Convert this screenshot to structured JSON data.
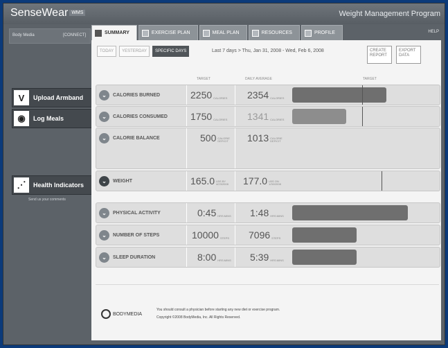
{
  "app": {
    "logo": "SenseWear",
    "logo_badge": "WMS",
    "program_title": "Weight Management Program",
    "help": "HELP"
  },
  "sidebar": {
    "media_label": "Body Media",
    "media_right": "[CONNECT]",
    "items": [
      {
        "label": "Upload Armband"
      },
      {
        "label": "Log Meals"
      },
      {
        "label": "Health Indicators"
      }
    ],
    "note": "Send us your comments"
  },
  "tabs": [
    {
      "label": "SUMMARY"
    },
    {
      "label": "EXERCISE PLAN"
    },
    {
      "label": "MEAL PLAN"
    },
    {
      "label": "RESOURCES"
    },
    {
      "label": "PROFILE"
    }
  ],
  "filters": {
    "today": "TODAY",
    "yesterday": "YESTERDAY",
    "specific": "SPECIFIC DAYS"
  },
  "range_text": "Last 7 days > Thu, Jan 31, 2008 - Wed, Feb 6, 2008",
  "actions": {
    "create_report": "CREATE REPORT",
    "export_data": "EXPORT DATA"
  },
  "columns": {
    "target": "TARGET",
    "daily_average": "DAILY AVERAGE",
    "target_bar": "TARGET"
  },
  "rows": [
    {
      "label": "CALORIES BURNED",
      "target": "2250",
      "target_unit": "CALORIES",
      "avg": "2354",
      "avg_unit": "CALORIES",
      "bar_fraction": 0.64
    },
    {
      "label": "CALORIES CONSUMED",
      "target": "1750",
      "target_unit": "CALORIES",
      "avg": "1341",
      "avg_unit": "CALORIES",
      "bar_fraction": 0.37
    },
    {
      "label": "CALORIE BALANCE",
      "target": "500",
      "target_unit": "CALORIE DEFICIT",
      "avg": "1013",
      "avg_unit": "CALORIE DEFICIT"
    },
    {
      "label": "WEIGHT",
      "target": "165.0",
      "target_unit": "LBS BY 4/23/2008",
      "avg": "177.0",
      "avg_unit": "LBS ON 1/30/2008"
    },
    {
      "label": "PHYSICAL ACTIVITY",
      "target": "0:45",
      "target_unit": "HRS:MINS",
      "avg": "1:48",
      "avg_unit": "HRS:MINS",
      "bar_fraction": 0.79
    },
    {
      "label": "NUMBER OF STEPS",
      "target": "10000",
      "target_unit": "STEPS",
      "avg": "7096",
      "avg_unit": "STEPS",
      "bar_fraction": 0.44
    },
    {
      "label": "SLEEP DURATION",
      "target": "8:00",
      "target_unit": "HRS:MINS",
      "avg": "5:39",
      "avg_unit": "HRS:MINS",
      "bar_fraction": 0.44
    }
  ],
  "footer": {
    "logo": "BODYMEDIA",
    "line1": "You should consult a physician before starting any new diet or exercise program.",
    "line2": "Copyright ©2008 BodyMedia, Inc. All Rights Reserved."
  }
}
